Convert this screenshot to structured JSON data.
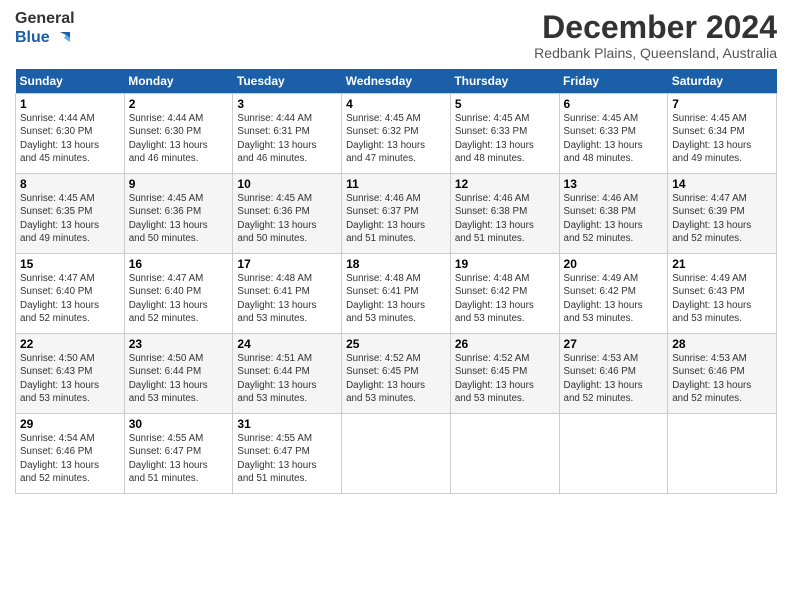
{
  "header": {
    "logo_line1": "General",
    "logo_line2": "Blue",
    "month_title": "December 2024",
    "location": "Redbank Plains, Queensland, Australia"
  },
  "days_of_week": [
    "Sunday",
    "Monday",
    "Tuesday",
    "Wednesday",
    "Thursday",
    "Friday",
    "Saturday"
  ],
  "weeks": [
    [
      {
        "day": "1",
        "info": "Sunrise: 4:44 AM\nSunset: 6:30 PM\nDaylight: 13 hours\nand 45 minutes."
      },
      {
        "day": "2",
        "info": "Sunrise: 4:44 AM\nSunset: 6:30 PM\nDaylight: 13 hours\nand 46 minutes."
      },
      {
        "day": "3",
        "info": "Sunrise: 4:44 AM\nSunset: 6:31 PM\nDaylight: 13 hours\nand 46 minutes."
      },
      {
        "day": "4",
        "info": "Sunrise: 4:45 AM\nSunset: 6:32 PM\nDaylight: 13 hours\nand 47 minutes."
      },
      {
        "day": "5",
        "info": "Sunrise: 4:45 AM\nSunset: 6:33 PM\nDaylight: 13 hours\nand 48 minutes."
      },
      {
        "day": "6",
        "info": "Sunrise: 4:45 AM\nSunset: 6:33 PM\nDaylight: 13 hours\nand 48 minutes."
      },
      {
        "day": "7",
        "info": "Sunrise: 4:45 AM\nSunset: 6:34 PM\nDaylight: 13 hours\nand 49 minutes."
      }
    ],
    [
      {
        "day": "8",
        "info": "Sunrise: 4:45 AM\nSunset: 6:35 PM\nDaylight: 13 hours\nand 49 minutes."
      },
      {
        "day": "9",
        "info": "Sunrise: 4:45 AM\nSunset: 6:36 PM\nDaylight: 13 hours\nand 50 minutes."
      },
      {
        "day": "10",
        "info": "Sunrise: 4:45 AM\nSunset: 6:36 PM\nDaylight: 13 hours\nand 50 minutes."
      },
      {
        "day": "11",
        "info": "Sunrise: 4:46 AM\nSunset: 6:37 PM\nDaylight: 13 hours\nand 51 minutes."
      },
      {
        "day": "12",
        "info": "Sunrise: 4:46 AM\nSunset: 6:38 PM\nDaylight: 13 hours\nand 51 minutes."
      },
      {
        "day": "13",
        "info": "Sunrise: 4:46 AM\nSunset: 6:38 PM\nDaylight: 13 hours\nand 52 minutes."
      },
      {
        "day": "14",
        "info": "Sunrise: 4:47 AM\nSunset: 6:39 PM\nDaylight: 13 hours\nand 52 minutes."
      }
    ],
    [
      {
        "day": "15",
        "info": "Sunrise: 4:47 AM\nSunset: 6:40 PM\nDaylight: 13 hours\nand 52 minutes."
      },
      {
        "day": "16",
        "info": "Sunrise: 4:47 AM\nSunset: 6:40 PM\nDaylight: 13 hours\nand 52 minutes."
      },
      {
        "day": "17",
        "info": "Sunrise: 4:48 AM\nSunset: 6:41 PM\nDaylight: 13 hours\nand 53 minutes."
      },
      {
        "day": "18",
        "info": "Sunrise: 4:48 AM\nSunset: 6:41 PM\nDaylight: 13 hours\nand 53 minutes."
      },
      {
        "day": "19",
        "info": "Sunrise: 4:48 AM\nSunset: 6:42 PM\nDaylight: 13 hours\nand 53 minutes."
      },
      {
        "day": "20",
        "info": "Sunrise: 4:49 AM\nSunset: 6:42 PM\nDaylight: 13 hours\nand 53 minutes."
      },
      {
        "day": "21",
        "info": "Sunrise: 4:49 AM\nSunset: 6:43 PM\nDaylight: 13 hours\nand 53 minutes."
      }
    ],
    [
      {
        "day": "22",
        "info": "Sunrise: 4:50 AM\nSunset: 6:43 PM\nDaylight: 13 hours\nand 53 minutes."
      },
      {
        "day": "23",
        "info": "Sunrise: 4:50 AM\nSunset: 6:44 PM\nDaylight: 13 hours\nand 53 minutes."
      },
      {
        "day": "24",
        "info": "Sunrise: 4:51 AM\nSunset: 6:44 PM\nDaylight: 13 hours\nand 53 minutes."
      },
      {
        "day": "25",
        "info": "Sunrise: 4:52 AM\nSunset: 6:45 PM\nDaylight: 13 hours\nand 53 minutes."
      },
      {
        "day": "26",
        "info": "Sunrise: 4:52 AM\nSunset: 6:45 PM\nDaylight: 13 hours\nand 53 minutes."
      },
      {
        "day": "27",
        "info": "Sunrise: 4:53 AM\nSunset: 6:46 PM\nDaylight: 13 hours\nand 52 minutes."
      },
      {
        "day": "28",
        "info": "Sunrise: 4:53 AM\nSunset: 6:46 PM\nDaylight: 13 hours\nand 52 minutes."
      }
    ],
    [
      {
        "day": "29",
        "info": "Sunrise: 4:54 AM\nSunset: 6:46 PM\nDaylight: 13 hours\nand 52 minutes."
      },
      {
        "day": "30",
        "info": "Sunrise: 4:55 AM\nSunset: 6:47 PM\nDaylight: 13 hours\nand 51 minutes."
      },
      {
        "day": "31",
        "info": "Sunrise: 4:55 AM\nSunset: 6:47 PM\nDaylight: 13 hours\nand 51 minutes."
      },
      {
        "day": "",
        "info": ""
      },
      {
        "day": "",
        "info": ""
      },
      {
        "day": "",
        "info": ""
      },
      {
        "day": "",
        "info": ""
      }
    ]
  ]
}
